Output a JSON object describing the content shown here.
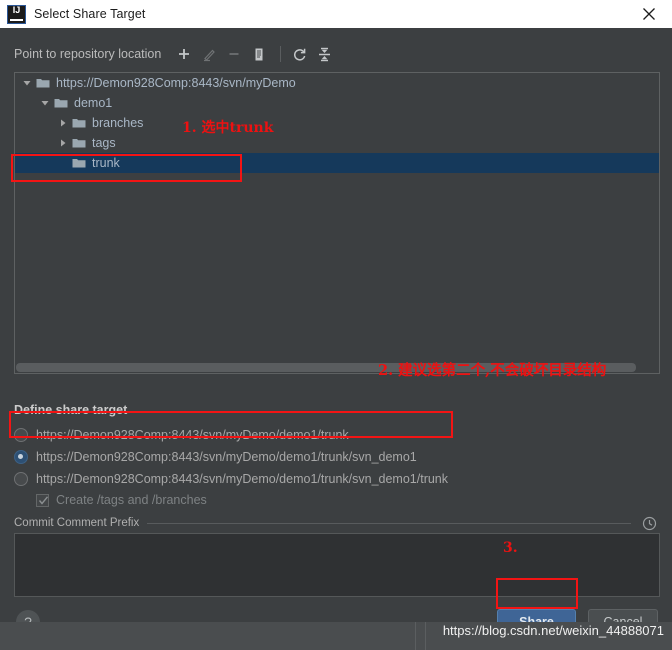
{
  "window": {
    "title": "Select Share Target",
    "app_icon": "intellij-idea-icon",
    "close_icon": "close-icon"
  },
  "toolbar": {
    "label": "Point to repository location",
    "buttons": [
      {
        "name": "add-repository-button",
        "icon": "plus-icon",
        "enabled": true
      },
      {
        "name": "edit-repository-button",
        "icon": "pencil-icon",
        "enabled": false
      },
      {
        "name": "remove-repository-button",
        "icon": "minus-icon",
        "enabled": false
      },
      {
        "name": "copy-url-button",
        "icon": "copy-icon",
        "enabled": true
      },
      {
        "name": "refresh-button",
        "icon": "refresh-icon",
        "enabled": true
      },
      {
        "name": "collapse-all-button",
        "icon": "collapse-all-icon",
        "enabled": true
      }
    ]
  },
  "tree": {
    "nodes": [
      {
        "label": "https://Demon928Comp:8443/svn/myDemo",
        "depth": 0,
        "expanded": true,
        "has_children": true,
        "selected": false
      },
      {
        "label": "demo1",
        "depth": 1,
        "expanded": true,
        "has_children": true,
        "selected": false
      },
      {
        "label": "branches",
        "depth": 2,
        "expanded": false,
        "has_children": true,
        "selected": false
      },
      {
        "label": "tags",
        "depth": 2,
        "expanded": false,
        "has_children": true,
        "selected": false
      },
      {
        "label": "trunk",
        "depth": 2,
        "expanded": false,
        "has_children": false,
        "selected": true
      }
    ]
  },
  "share_target": {
    "section_label": "Define share target",
    "options": [
      {
        "label": "https://Demon928Comp:8443/svn/myDemo/demo1/trunk",
        "selected": false
      },
      {
        "label": "https://Demon928Comp:8443/svn/myDemo/demo1/trunk/svn_demo1",
        "selected": true
      },
      {
        "label": "https://Demon928Comp:8443/svn/myDemo/demo1/trunk/svn_demo1/trunk",
        "selected": false
      }
    ],
    "checkbox": {
      "label": "Create /tags and /branches",
      "checked": true,
      "enabled": false
    }
  },
  "commit_comment": {
    "label": "Commit Comment Prefix",
    "history_icon": "clock-icon",
    "value": "",
    "placeholder": ""
  },
  "footer": {
    "help_label": "?",
    "share_label": "Share",
    "cancel_label": "Cancel"
  },
  "annotations": [
    {
      "name": "annotation-step-1",
      "text": "1. 选中trunk"
    },
    {
      "name": "annotation-step-2",
      "text": "2. 建议选第二个,不会破坏目录结构"
    },
    {
      "name": "annotation-step-3",
      "text": "3."
    }
  ],
  "watermark": {
    "text": "https://blog.csdn.net/weixin_44888071"
  },
  "colors": {
    "dialog_background": "#3c3f41",
    "titlebar_background": "#ffffff",
    "tree_selection": "#15395b",
    "accent_button": "#3f6596",
    "annotation_red": "#ee1111"
  }
}
